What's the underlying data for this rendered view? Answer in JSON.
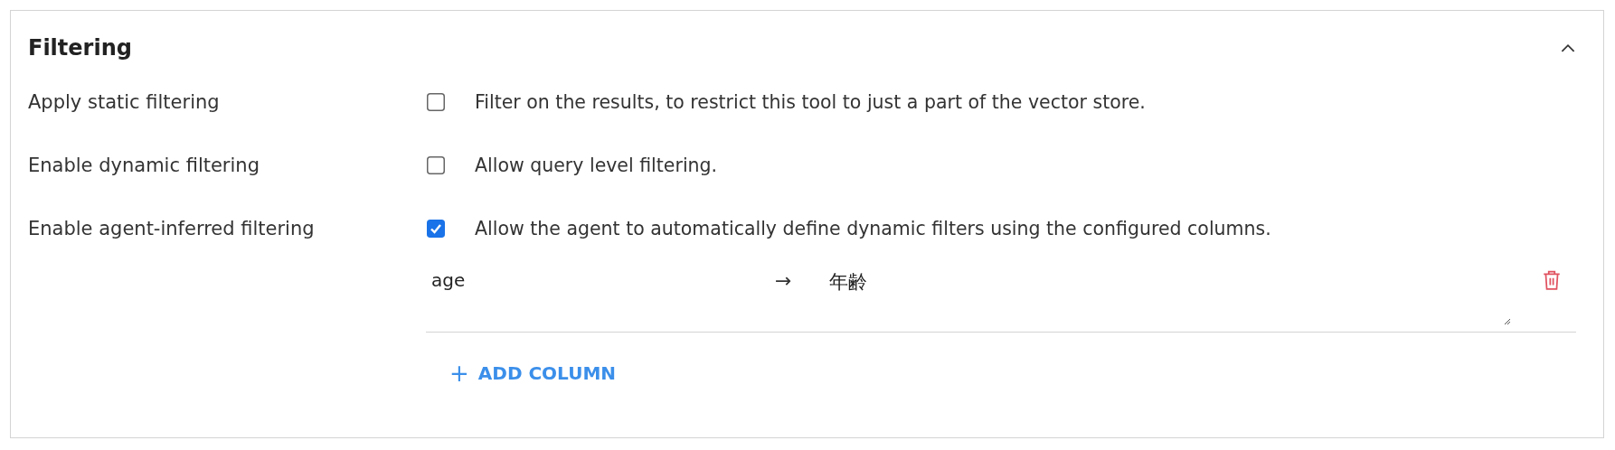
{
  "section": {
    "title": "Filtering",
    "expanded": true
  },
  "options": [
    {
      "label": "Apply static filtering",
      "checked": false,
      "description": "Filter on the results, to restrict this tool to just a part of the vector store."
    },
    {
      "label": "Enable dynamic filtering",
      "checked": false,
      "description": "Allow query level filtering."
    },
    {
      "label": "Enable agent-inferred filtering",
      "checked": true,
      "description": "Allow the agent to automatically define dynamic filters using the configured columns."
    }
  ],
  "columns": [
    {
      "name": "age",
      "arrow": "→",
      "target": "年齢"
    }
  ],
  "add_button": {
    "icon": "+",
    "label": "ADD COLUMN"
  }
}
